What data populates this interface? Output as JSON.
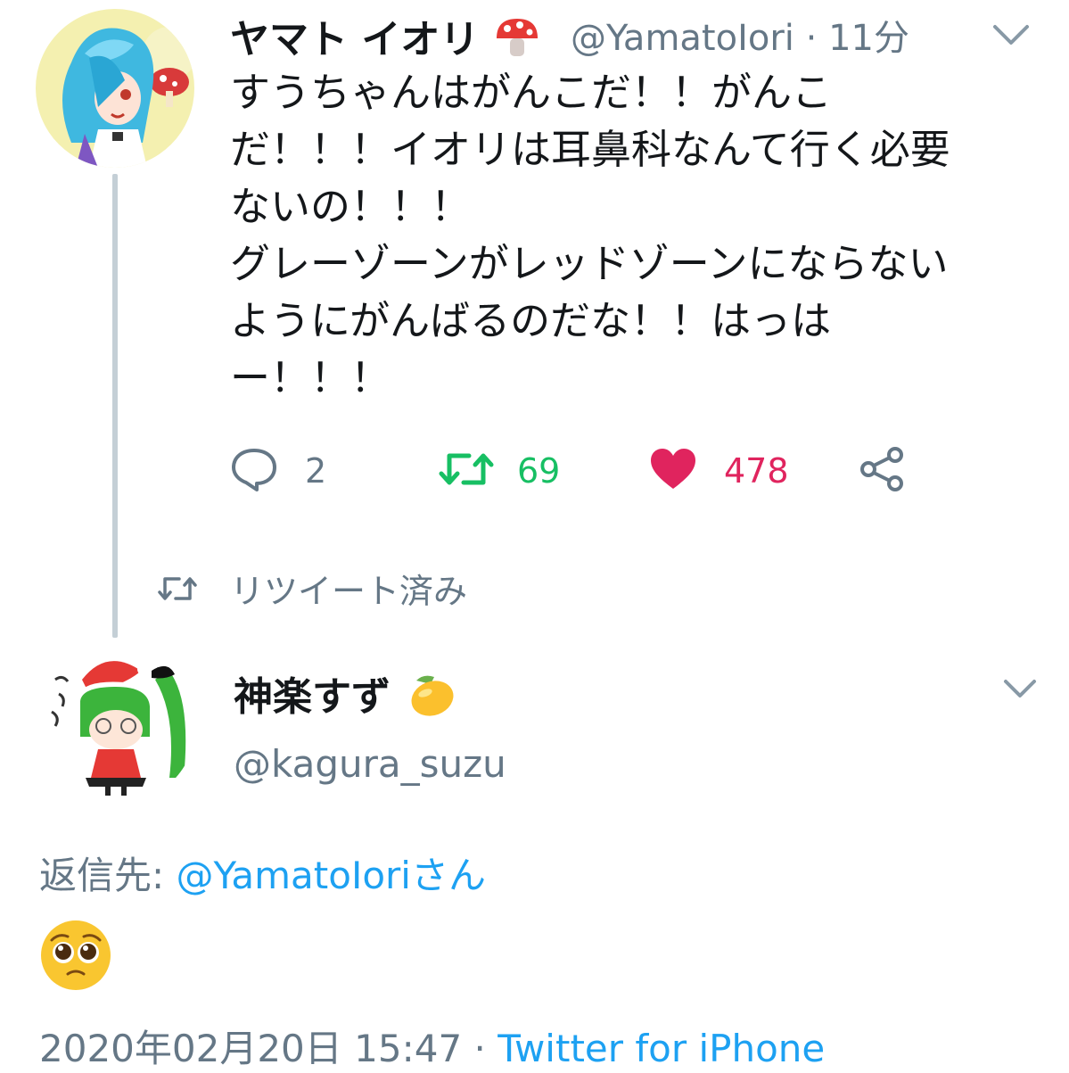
{
  "tweet1": {
    "display_name": "ヤマト イオリ",
    "name_emoji_icon": "mushroom-icon",
    "handle": "@YamatoIori",
    "separator": "·",
    "time": "11分",
    "body_lines": [
      "すうちゃんはがんこだ！！がんこ",
      "だ！！！イオリは耳鼻科なんて行く必要",
      "ないの！！！",
      "グレーゾーンがレッドゾーンにならない",
      "ようにがんばるのだな！！はっは",
      "ー！！！"
    ],
    "actions": {
      "reply_count": "2",
      "retweet_count": "69",
      "like_count": "478",
      "retweet_color": "#17bf63",
      "like_color": "#e0245e"
    }
  },
  "retweet_status": "リツイート済み",
  "tweet2": {
    "display_name": "神楽すず",
    "name_emoji_icon": "lemon-icon",
    "handle": "@kagura_suzu",
    "reply_to_prefix": "返信先: ",
    "reply_to_user": "@YamatoIoriさん",
    "body_emoji_icon": "pleading-face-icon",
    "date": "2020年02月20日 15:47",
    "separator": "·",
    "source": "Twitter for iPhone"
  },
  "colors": {
    "link": "#1da1f2",
    "muted": "#657786",
    "thread_line": "#c4cfd6"
  }
}
